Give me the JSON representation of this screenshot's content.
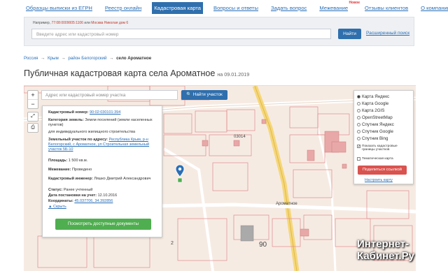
{
  "nav": {
    "items": [
      {
        "label": "Образцы выписки из ЕГРН"
      },
      {
        "label": "Реестр онлайн"
      },
      {
        "label": "Кадастровая карта"
      },
      {
        "label": "Вопросы и ответы"
      },
      {
        "label": "Задать вопрос"
      },
      {
        "label": "Межевание"
      },
      {
        "label": "Отзывы клиентов"
      },
      {
        "label": "О компании"
      }
    ],
    "active_index": 2,
    "badge": "Новое"
  },
  "search": {
    "hint_prefix": "Например,",
    "hint_example1": "77:08:0009005:1106",
    "hint_or": "или",
    "hint_example2": "Москва Николая дом 6",
    "placeholder": "Введите адрес или кадастровый номер",
    "button": "Найти",
    "advanced": "Расширенный поиск"
  },
  "breadcrumb": {
    "items": [
      "Россия",
      "Крым",
      "район Белогорский"
    ],
    "separator": "→",
    "current": "село Ароматное"
  },
  "page": {
    "title": "Публичная кадастровая карта села Ароматное",
    "date": "на 09.01.2019"
  },
  "map": {
    "zoom_in": "+",
    "zoom_out": "−",
    "search_placeholder": "Адрес или кадастровый номер участка",
    "search_button": "Найти участок",
    "labels": {
      "block": "03014",
      "street": "Ароматное",
      "num2": "2",
      "num90": "90"
    }
  },
  "info": {
    "cad_number_label": "Кадастровый номер:",
    "cad_number": "90:02:030101:394",
    "category_label": "Категория земель:",
    "category": "Земли поселений (земли населенных пунктов)",
    "use": "для индивидуального жилищного строительства",
    "address_label": "Земельный участок по адресу:",
    "address": "Республика Крым, р-н Белогорский, с Ароматное, ул Строительная земельный участок 5Б-10",
    "area_label": "Площадь:",
    "area": "1 500 кв.м.",
    "survey_label": "Межевание:",
    "survey": "Проведено",
    "engineer_label": "Кадастровый инженер:",
    "engineer": "Ляшко Дмитрий Александрович",
    "status_label": "Статус:",
    "status": "Ранее учтенный",
    "reg_date_label": "Дата постановки на учет:",
    "reg_date": "12.10.2016",
    "coords_label": "Координаты:",
    "coords": "45.037706, 34.392856",
    "hide": "▲ Скрыть",
    "button": "Посмотреть доступные документы"
  },
  "layers": {
    "options": [
      "Карта Яндекс",
      "Карта Google",
      "Карта 2GIS",
      "OpenStreetMap",
      "Спутник Яндекс",
      "Спутник Google",
      "Спутник Bing"
    ],
    "selected_index": 0,
    "show_borders": "Показать кадастровые границы участков",
    "thematic": "Тематическая карта",
    "share": "Поделиться ссылкой",
    "settings": "Настроить карту"
  },
  "watermark": {
    "line1": "Интернет-",
    "line2": "Кабинет.Ру"
  }
}
